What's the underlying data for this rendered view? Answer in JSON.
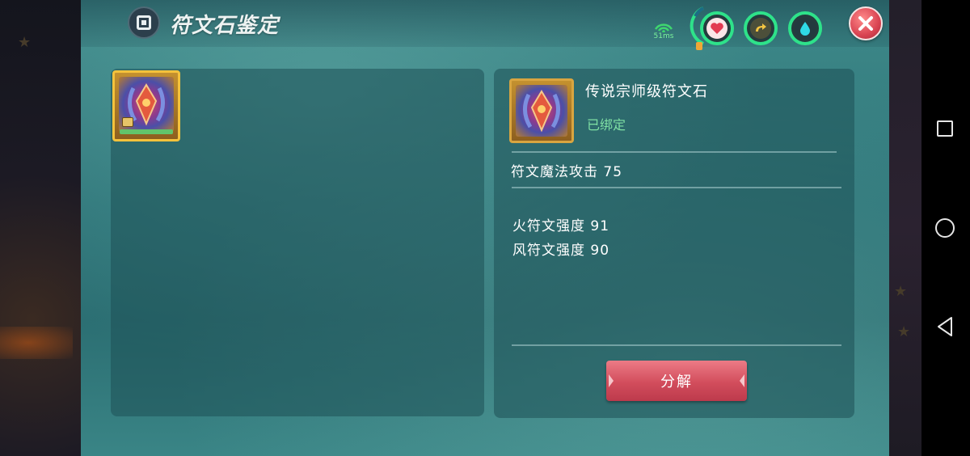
{
  "window": {
    "title": "符文石鉴定",
    "ping": "51ms"
  },
  "status_icons": [
    "heart-icon",
    "arrow-icon",
    "water-drop-icon"
  ],
  "inventory": {
    "items": [
      {
        "icon": "rune-stone-icon",
        "locked": true
      }
    ]
  },
  "detail": {
    "name": "传说宗师级符文石",
    "bind_status": "已绑定",
    "main_stat": "符文魔法攻击 75",
    "sub_stats": [
      "火符文强度 91",
      "风符文强度 90"
    ],
    "decompose_label": "分解"
  },
  "colors": {
    "accent_green": "#2ee28a",
    "button_red": "#d24d5c",
    "bind_green": "#7fe0a4",
    "frame_gold": "#f4c23c"
  }
}
